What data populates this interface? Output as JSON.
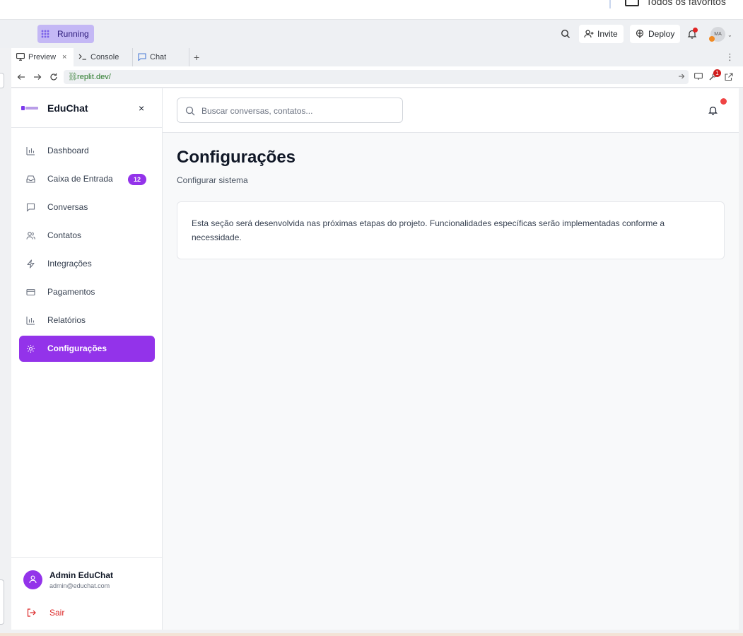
{
  "favorites_bar": {
    "label": "Todos os favoritos"
  },
  "replit_header": {
    "run_label": "Running",
    "invite_label": "Invite",
    "deploy_label": "Deploy",
    "avatar_initials": "MA"
  },
  "tabs": [
    {
      "label": "Preview",
      "close": "×"
    },
    {
      "label": "Console"
    },
    {
      "label": "Chat"
    }
  ],
  "tab_add": "+",
  "tab_menu": "⋮",
  "url_bar": {
    "url": ".replit.dev/",
    "devtools_badge": "1"
  },
  "sidebar": {
    "brand": "EduChat",
    "close": "×",
    "items": [
      {
        "label": "Dashboard",
        "icon": "bar-chart-icon"
      },
      {
        "label": "Caixa de Entrada",
        "icon": "inbox-icon",
        "badge": "12"
      },
      {
        "label": "Conversas",
        "icon": "message-square-icon"
      },
      {
        "label": "Contatos",
        "icon": "users-icon"
      },
      {
        "label": "Integrações",
        "icon": "zap-icon"
      },
      {
        "label": "Pagamentos",
        "icon": "credit-card-icon"
      },
      {
        "label": "Relatórios",
        "icon": "bar-chart-icon"
      },
      {
        "label": "Configurações",
        "icon": "gear-icon",
        "active": true
      }
    ],
    "user": {
      "name": "Admin EduChat",
      "email": "admin@educhat.com"
    },
    "logout": "Sair"
  },
  "main": {
    "search_placeholder": "Buscar conversas, contatos...",
    "title": "Configurações",
    "subtitle": "Configurar sistema",
    "card_text": "Esta seção será desenvolvida nas próximas etapas do projeto. Funcionalidades específicas serão implementadas conforme a necessidade."
  },
  "colors": {
    "accent": "#9333ea",
    "danger": "#dc2626",
    "notification": "#ef4444"
  }
}
